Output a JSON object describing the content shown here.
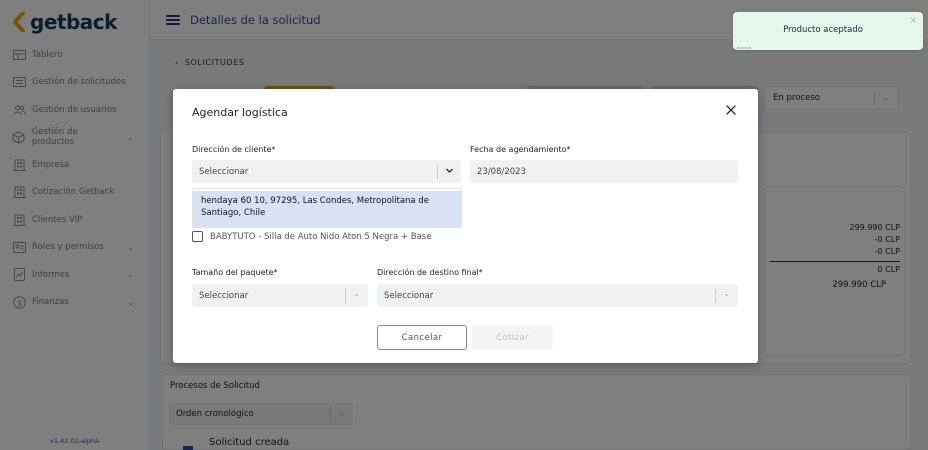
{
  "app": {
    "logo_text": "getback",
    "version": "v1.42.02-alpha"
  },
  "header": {
    "page_title": "Detalles de la solicitud"
  },
  "breadcrumb": {
    "label": "SOLICITUDES"
  },
  "sidebar": {
    "items": [
      {
        "label": "Tablero",
        "icon": "dashboard-icon"
      },
      {
        "label": "Gestión de solicitudes",
        "icon": "requests-icon"
      },
      {
        "label": "Gestión de usuarios",
        "icon": "users-icon"
      },
      {
        "label": "Gestión de productos",
        "icon": "box-icon",
        "expandable": true
      },
      {
        "label": "Empresa",
        "icon": "building-icon"
      },
      {
        "label": "Cotización Getback",
        "icon": "building-icon"
      },
      {
        "label": "Clientes VIP",
        "icon": "building-icon"
      },
      {
        "label": "Roles y permisos",
        "icon": "roles-icon",
        "expandable": true
      },
      {
        "label": "Informes",
        "icon": "report-icon",
        "expandable": true
      },
      {
        "label": "Finanzas",
        "icon": "dollar-icon",
        "expandable": true
      }
    ]
  },
  "status_select": {
    "value": "En proceso"
  },
  "summary": {
    "prices": [
      "299.990 CLP",
      "-0 CLP",
      "-0 CLP",
      "0 CLP"
    ],
    "total": "299.990 CLP"
  },
  "procesos": {
    "title": "Procesos de Solicitud",
    "order_select": "Orden cronológico",
    "first_event": "Solicitud creada"
  },
  "toast": {
    "message": "Producto aceptado"
  },
  "modal": {
    "title": "Agendar logística",
    "client_address": {
      "label": "Dirección de cliente*",
      "value": "Seleccionar",
      "option": "hendaya 60 10, 97295, Las Condes, Metropolitana de Santiago, Chile"
    },
    "schedule_date": {
      "label": "Fecha de agendamiento*",
      "value": "23/08/2023"
    },
    "product_checkbox": {
      "label": "BABYTUTO - Silla de Auto Nido Aton 5 Negra + Base",
      "checked": false
    },
    "package_size": {
      "label": "Tamaño del paquete*",
      "value": "Seleccionar"
    },
    "final_address": {
      "label": "Dirección de destino final*",
      "value": "Seleccionar"
    },
    "cancel_label": "Cancelar",
    "quote_label": "Cotizar"
  },
  "colors": {
    "brand": "#123b5a",
    "accent": "#f2a313",
    "primary": "#2d4aa5",
    "toast_bg": "#e7f6ea"
  }
}
